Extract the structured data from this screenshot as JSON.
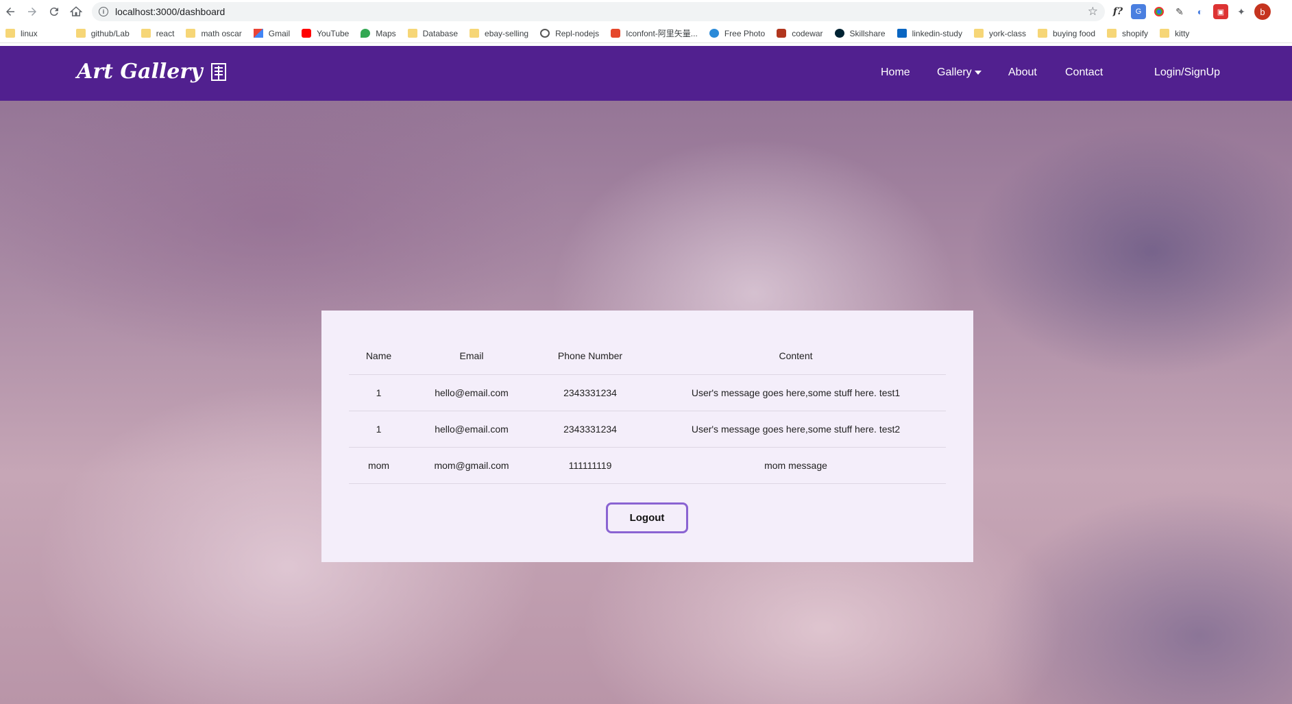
{
  "browser": {
    "url": "localhost:3000/dashboard",
    "bookmarks": [
      {
        "label": "linux",
        "icon": "folder-icon"
      },
      {
        "label": "",
        "icon": "codepen-icon"
      },
      {
        "label": "github/Lab",
        "icon": "folder-icon"
      },
      {
        "label": "react",
        "icon": "folder-icon"
      },
      {
        "label": "math oscar",
        "icon": "folder-icon"
      },
      {
        "label": "Gmail",
        "icon": "gmail-icon"
      },
      {
        "label": "YouTube",
        "icon": "youtube-icon"
      },
      {
        "label": "Maps",
        "icon": "maps-icon"
      },
      {
        "label": "Database",
        "icon": "folder-icon"
      },
      {
        "label": "ebay-selling",
        "icon": "folder-icon"
      },
      {
        "label": "Repl-nodejs",
        "icon": "replit-icon"
      },
      {
        "label": "Iconfont-阿里矢量...",
        "icon": "iconfont-icon"
      },
      {
        "label": "Free Photo",
        "icon": "pixabay-icon"
      },
      {
        "label": "codewar",
        "icon": "codewars-icon"
      },
      {
        "label": "Skillshare",
        "icon": "skillshare-icon"
      },
      {
        "label": "linkedin-study",
        "icon": "linkedin-icon"
      },
      {
        "label": "york-class",
        "icon": "folder-icon"
      },
      {
        "label": "buying food",
        "icon": "folder-icon"
      },
      {
        "label": "shopify",
        "icon": "folder-icon"
      },
      {
        "label": "kitty",
        "icon": "folder-icon"
      }
    ],
    "profile_initial": "b"
  },
  "navbar": {
    "brand": "Art Gallery",
    "links": {
      "home": "Home",
      "gallery": "Gallery",
      "about": "About",
      "contact": "Contact",
      "login": "Login/SignUp"
    },
    "color": "#51208f"
  },
  "table": {
    "headers": [
      "Name",
      "Email",
      "Phone Number",
      "Content"
    ],
    "rows": [
      [
        "1",
        "hello@email.com",
        "2343331234",
        "User's message goes here,some stuff here. test1"
      ],
      [
        "1",
        "hello@email.com",
        "2343331234",
        "User's message goes here,some stuff here. test2"
      ],
      [
        "mom",
        "mom@gmail.com",
        "111111119",
        "mom message"
      ]
    ]
  },
  "logout_label": "Logout",
  "accent_color": "#8a63d2"
}
